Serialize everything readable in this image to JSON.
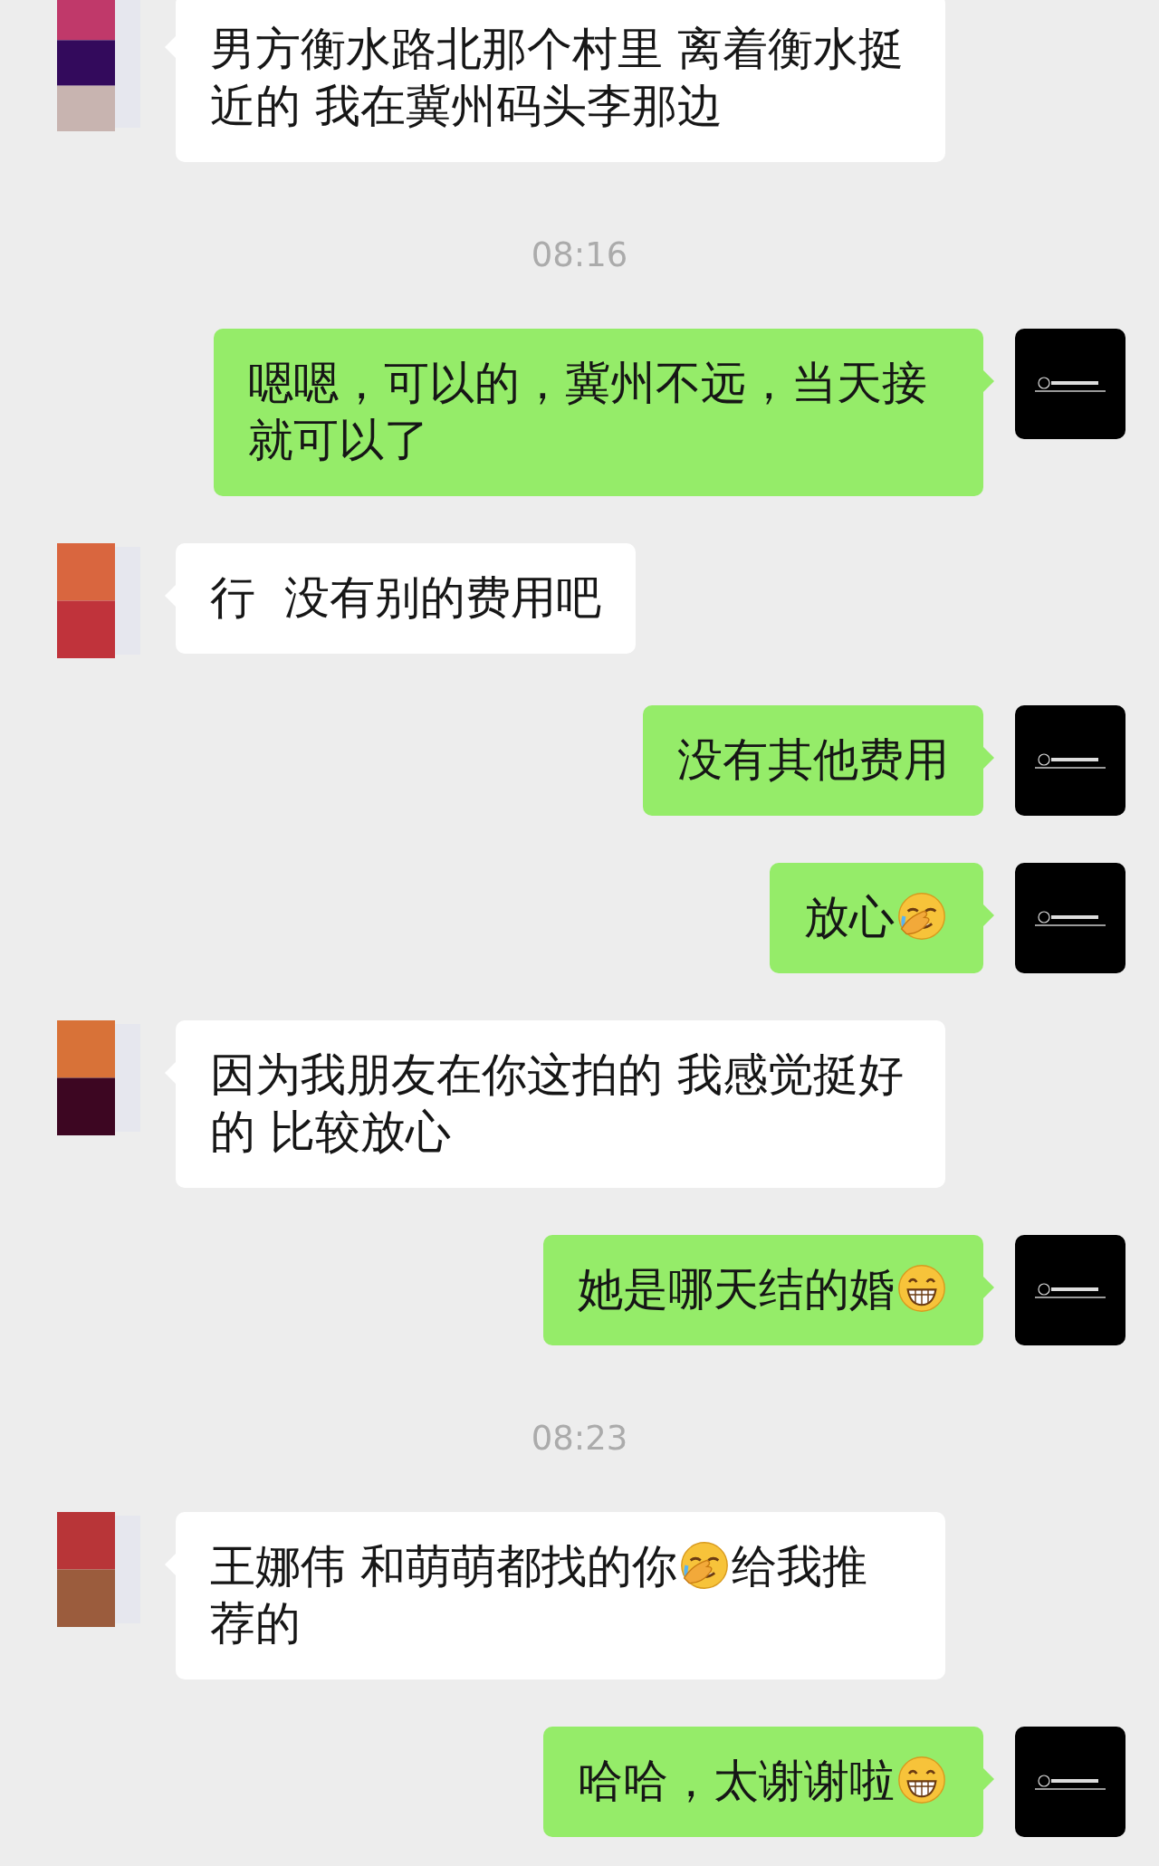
{
  "chat": [
    {
      "kind": "received",
      "parts": [
        {
          "kind": "text",
          "text": "男方衡水路北那个村里 离着衡水挺近的 我在冀州码头李那边"
        }
      ]
    },
    {
      "kind": "time",
      "text": "08:16"
    },
    {
      "kind": "sent",
      "parts": [
        {
          "kind": "text",
          "text": "嗯嗯，可以的，冀州不远，当天接就可以了"
        }
      ]
    },
    {
      "kind": "received",
      "parts": [
        {
          "kind": "text",
          "text": "行  没有别的费用吧"
        }
      ]
    },
    {
      "kind": "sent",
      "parts": [
        {
          "kind": "text",
          "text": "没有其他费用"
        }
      ]
    },
    {
      "kind": "sent",
      "parts": [
        {
          "kind": "text",
          "text": "放心"
        },
        {
          "kind": "facepalm"
        }
      ]
    },
    {
      "kind": "received",
      "parts": [
        {
          "kind": "text",
          "text": "因为我朋友在你这拍的 我感觉挺好的 比较放心"
        }
      ]
    },
    {
      "kind": "sent",
      "parts": [
        {
          "kind": "text",
          "text": "她是哪天结的婚"
        },
        {
          "kind": "grin"
        }
      ]
    },
    {
      "kind": "time",
      "text": "08:23"
    },
    {
      "kind": "received",
      "parts": [
        {
          "kind": "text",
          "text": "王娜伟 和萌萌都找的你"
        },
        {
          "kind": "facepalm"
        },
        {
          "kind": "text",
          "text": "给我推荐的"
        }
      ]
    },
    {
      "kind": "sent",
      "parts": [
        {
          "kind": "text",
          "text": "哈哈，太谢谢啦"
        },
        {
          "kind": "grin"
        }
      ]
    }
  ]
}
